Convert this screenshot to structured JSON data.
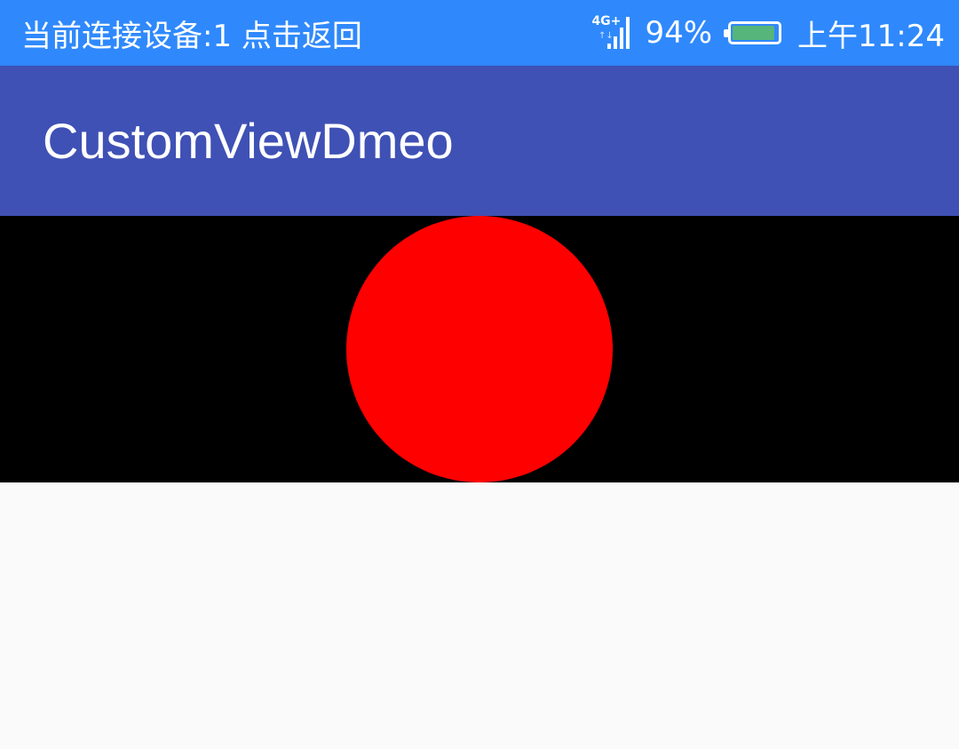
{
  "status_bar": {
    "left_text": "当前连接设备:1  点击返回",
    "network_type": "4G+",
    "battery_percent_text": "94%",
    "battery_level": 0.94,
    "time": "上午11:24"
  },
  "app_bar": {
    "title": "CustomViewDmeo"
  },
  "custom_view": {
    "background_color": "#000000",
    "circle_color": "#ff0000"
  },
  "colors": {
    "status_bar": "#2f89fc",
    "app_bar": "#3f51b5",
    "content": "#fafafa",
    "battery_fill": "#55b57a"
  }
}
